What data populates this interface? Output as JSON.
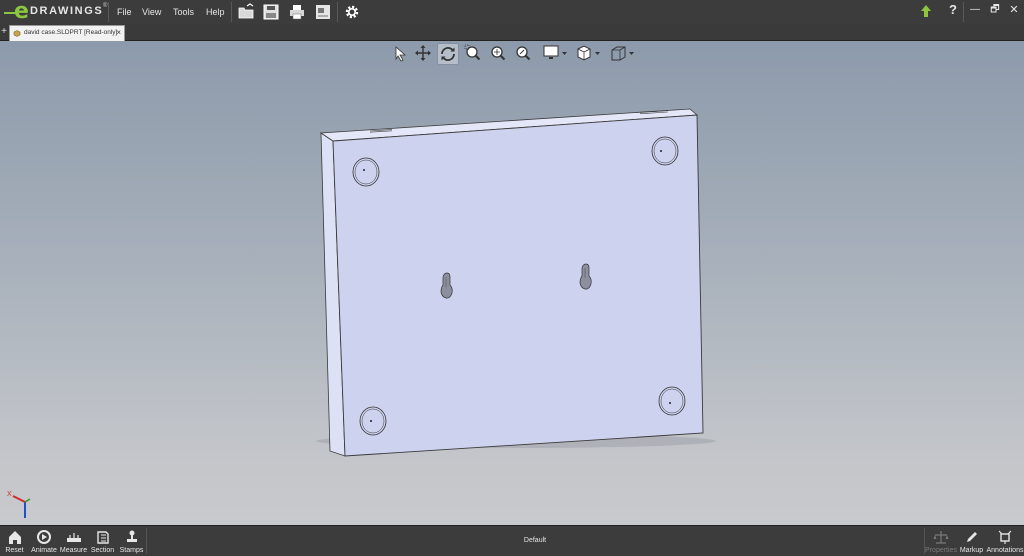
{
  "app": {
    "logo_letter": "e",
    "logo_word": "DRAWINGS",
    "logo_mark": "®"
  },
  "menu": [
    "File",
    "View",
    "Tools",
    "Help"
  ],
  "title_toolbar_icons": [
    "open-file-icon",
    "save-icon",
    "print-icon",
    "drawing-sheet-icon",
    "gear-icon"
  ],
  "window_controls": {
    "update_icon": "green-arrow-up-icon",
    "help": "?",
    "minimize": "—",
    "restore": "🗗",
    "close": "✕"
  },
  "tab": {
    "label": "david case.SLDPRT [Read-only]",
    "close": "×",
    "plus": "+"
  },
  "view_toolbar_icons": [
    "select-icon",
    "pan-icon",
    "rotate-icon",
    "zoom-to-area-icon",
    "zoom-to-fit-icon",
    "zoom-icon",
    "display-style-icon",
    "view-orientation-icon",
    "projection-icon"
  ],
  "viewport": {
    "active_tool": "rotate"
  },
  "triad": {
    "x_label": "X"
  },
  "bottom_left": [
    "Reset",
    "Animate",
    "Measure",
    "Section",
    "Stamps"
  ],
  "status_text": "Default",
  "bottom_right": [
    "Properties",
    "Markup",
    "Annotations"
  ],
  "colors": {
    "accent_green": "#8cc63f",
    "chrome": "#3c3c3c",
    "model_face": "#cdd2ee"
  }
}
